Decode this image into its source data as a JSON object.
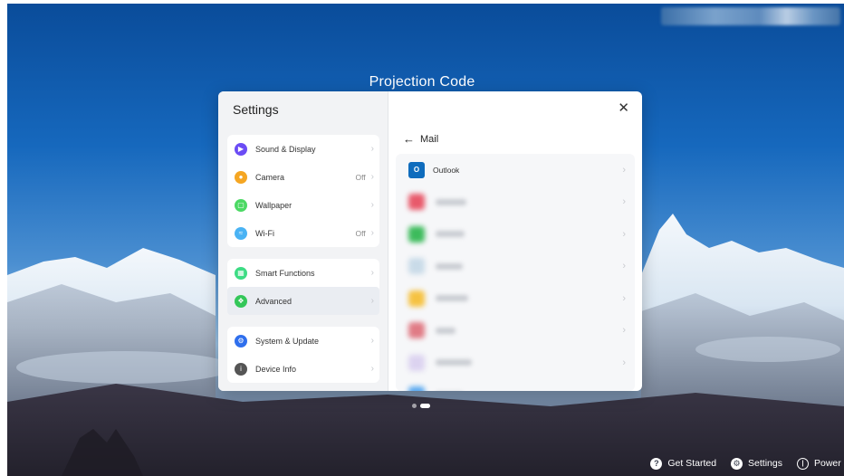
{
  "screen": {
    "title": "Projection Code"
  },
  "settings_dialog": {
    "title": "Settings",
    "close_icon": "close-icon",
    "groups": [
      {
        "items": [
          {
            "label": "Sound & Display",
            "value": "",
            "icon": "sound-icon",
            "icon_color": "#6b4cf5"
          },
          {
            "label": "Camera",
            "value": "Off",
            "icon": "camera-icon",
            "icon_color": "#f5a623"
          },
          {
            "label": "Wallpaper",
            "value": "",
            "icon": "wallpaper-icon",
            "icon_color": "#4cd964"
          },
          {
            "label": "Wi-Fi",
            "value": "Off",
            "icon": "wifi-icon",
            "icon_color": "#4ab3f4"
          }
        ]
      },
      {
        "items": [
          {
            "label": "Smart Functions",
            "value": "",
            "icon": "smart-functions-icon",
            "icon_color": "#3ddc84"
          },
          {
            "label": "Advanced",
            "value": "",
            "icon": "advanced-icon",
            "icon_color": "#34c759",
            "selected": true
          }
        ]
      },
      {
        "items": [
          {
            "label": "System & Update",
            "value": "",
            "icon": "system-update-icon",
            "icon_color": "#2f6fed"
          },
          {
            "label": "Device Info",
            "value": "",
            "icon": "info-icon",
            "icon_color": "#555555"
          }
        ]
      }
    ],
    "detail": {
      "back_label": "Mail",
      "mail_apps": [
        {
          "label": "Outlook",
          "icon": "outlook-icon",
          "blurred": false
        },
        {
          "label": "",
          "icon": "blurred-app-icon",
          "blurred": true,
          "icon_color": "#e85a6b"
        },
        {
          "label": "",
          "icon": "blurred-app-icon",
          "blurred": true,
          "icon_color": "#3dbb5c"
        },
        {
          "label": "",
          "icon": "blurred-app-icon",
          "blurred": true,
          "icon_color": "#c9dbe8"
        },
        {
          "label": "",
          "icon": "blurred-app-icon",
          "blurred": true,
          "icon_color": "#f5c242"
        },
        {
          "label": "",
          "icon": "blurred-app-icon",
          "blurred": true,
          "icon_color": "#e07b85"
        },
        {
          "label": "",
          "icon": "blurred-app-icon",
          "blurred": true,
          "icon_color": "#dcd3f0"
        },
        {
          "label": "",
          "icon": "blurred-app-icon",
          "blurred": true,
          "icon_color": "#5aa9f0"
        }
      ]
    }
  },
  "bottom_bar": {
    "items": [
      {
        "label": "Get Started",
        "icon": "help-icon"
      },
      {
        "label": "Settings",
        "icon": "gear-icon"
      },
      {
        "label": "Power",
        "icon": "power-icon"
      }
    ]
  },
  "colors": {
    "accent": "#0f6cbd",
    "selected_row": "#eaedf2"
  }
}
